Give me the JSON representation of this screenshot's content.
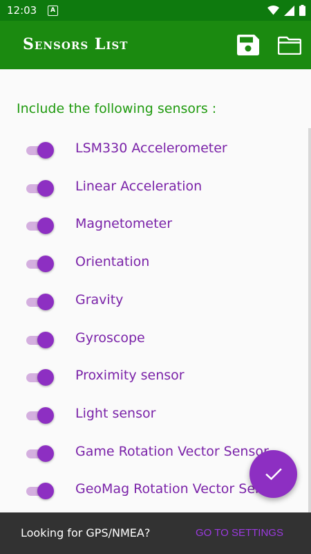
{
  "status_bar": {
    "time": "12:03",
    "notification_letter": "A",
    "icons": [
      "wifi-icon",
      "signal-icon",
      "battery-icon"
    ]
  },
  "app_bar": {
    "title": "Sensors List",
    "actions": [
      "save-icon",
      "folder-icon"
    ]
  },
  "content": {
    "heading": "Include the following sensors :",
    "sensors": [
      {
        "label": "LSM330 Accelerometer",
        "enabled": true
      },
      {
        "label": "Linear Acceleration",
        "enabled": true
      },
      {
        "label": "Magnetometer",
        "enabled": true
      },
      {
        "label": "Orientation",
        "enabled": true
      },
      {
        "label": "Gravity",
        "enabled": true
      },
      {
        "label": "Gyroscope",
        "enabled": true
      },
      {
        "label": "Proximity sensor",
        "enabled": true
      },
      {
        "label": "Light sensor",
        "enabled": true
      },
      {
        "label": "Game Rotation Vector Sensor",
        "enabled": true
      },
      {
        "label": "GeoMag Rotation Vector Sensor",
        "enabled": true
      }
    ]
  },
  "fab": {
    "icon": "check-icon"
  },
  "snackbar": {
    "message": "Looking for GPS/NMEA?",
    "action": "GO TO SETTINGS"
  },
  "colors": {
    "status_bar": "#0e7a0e",
    "app_bar": "#1b8a10",
    "heading": "#1f9a0e",
    "accent": "#8d2fc2",
    "label": "#7a22a8",
    "snackbar": "#323232"
  }
}
